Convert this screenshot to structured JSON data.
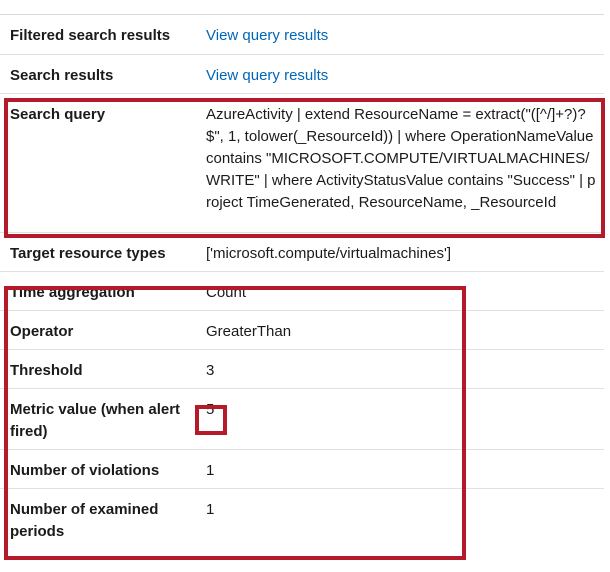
{
  "rows": {
    "filtered_search_results": {
      "label": "Filtered search results",
      "value": "View query results"
    },
    "search_results": {
      "label": "Search results",
      "value": "View query results"
    },
    "search_query": {
      "label": "Search query",
      "value": "AzureActivity | extend ResourceName = extract(\"([^/]+?)?$\", 1, tolower(_ResourceId)) | where OperationNameValue contains \"MICROSOFT.COMPUTE/VIRTUALMACHINES/WRITE\" | where ActivityStatusValue contains \"Success\" | project TimeGenerated, ResourceName, _ResourceId"
    },
    "target_resource_types": {
      "label": "Target resource types",
      "value": "['microsoft.compute/virtualmachines']"
    },
    "time_aggregation": {
      "label": "Time aggregation",
      "value": "Count"
    },
    "operator": {
      "label": "Operator",
      "value": "GreaterThan"
    },
    "threshold": {
      "label": "Threshold",
      "value": "3"
    },
    "metric_value": {
      "label": "Metric value (when alert fired)",
      "value": "5"
    },
    "number_of_violations": {
      "label": "Number of violations",
      "value": "1"
    },
    "number_of_examined_periods": {
      "label": "Number of examined periods",
      "value": "1"
    }
  },
  "colors": {
    "link": "#0067b8",
    "highlight": "#b51a2a",
    "divider": "#e1e1e1"
  }
}
